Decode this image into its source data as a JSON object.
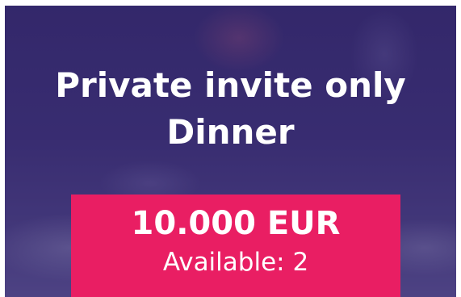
{
  "card": {
    "title": "Private invite only Dinner",
    "price": "10.000 EUR",
    "availability": "Available: 2"
  },
  "colors": {
    "overlay": "#3c2f6e",
    "price_box": "#e91e63",
    "text": "#ffffff"
  }
}
